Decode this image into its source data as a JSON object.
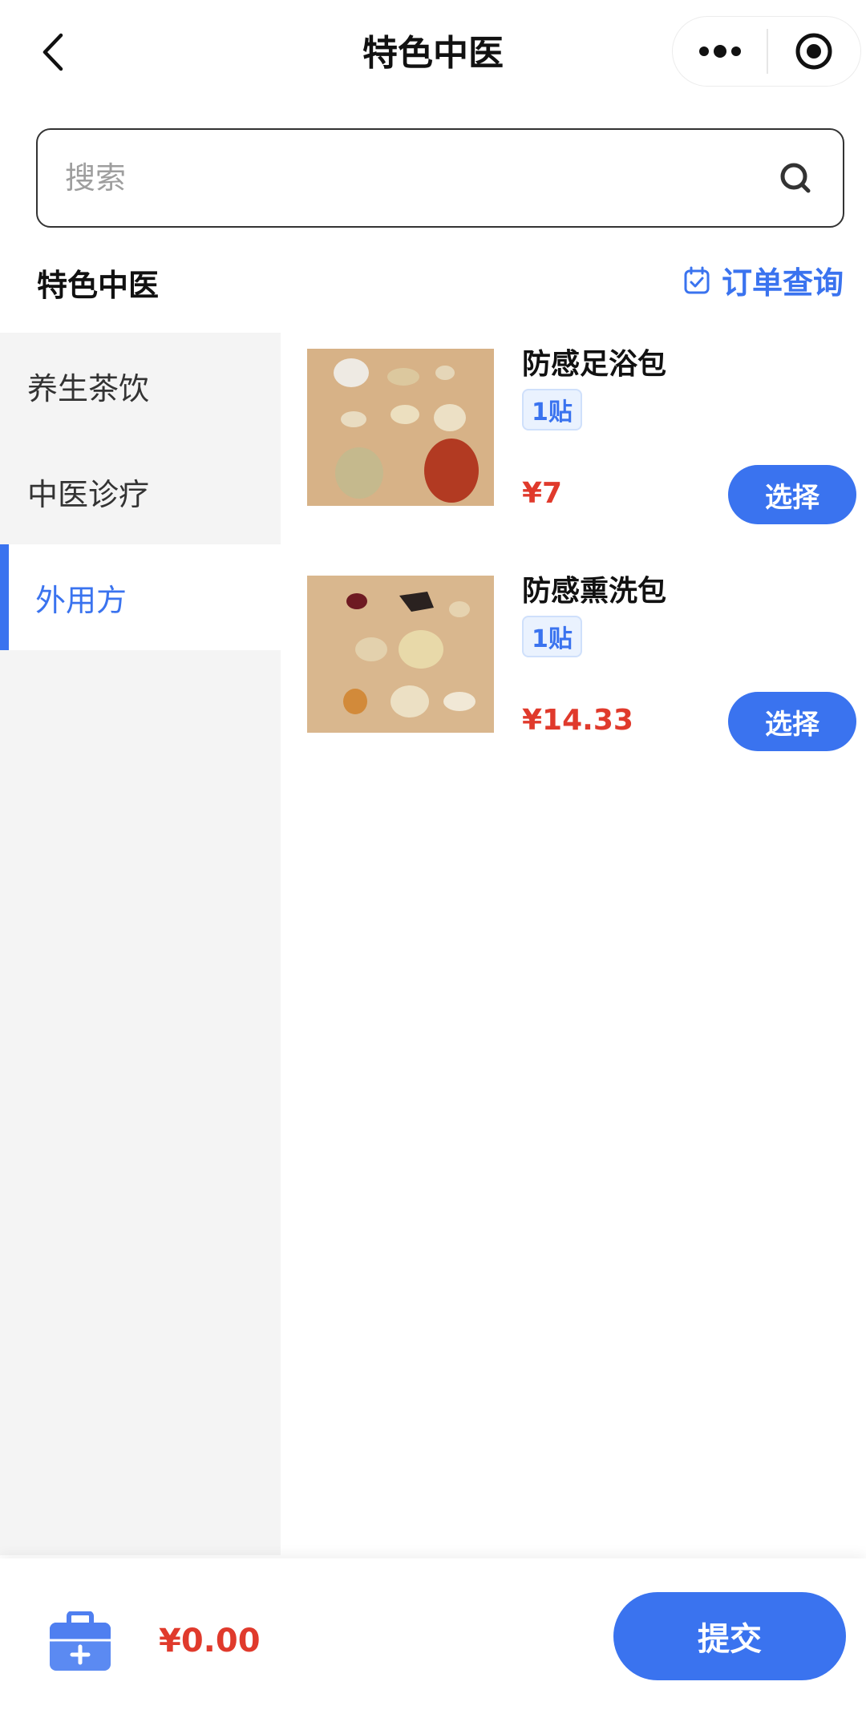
{
  "nav": {
    "title": "特色中医",
    "back_icon": "chevron-left-icon",
    "more_icon": "more-dots-icon",
    "close_icon": "target-close-icon"
  },
  "search": {
    "placeholder": "搜索",
    "value": "",
    "icon": "search-icon"
  },
  "section": {
    "title": "特色中医",
    "order_query": {
      "label": "订单查询",
      "icon": "calendar-check-icon"
    }
  },
  "sidebar": {
    "items": [
      {
        "label": "养生茶饮",
        "active": false
      },
      {
        "label": "中医诊疗",
        "active": false
      },
      {
        "label": "外用方",
        "active": true
      }
    ]
  },
  "products": [
    {
      "name": "防感足浴包",
      "unit": "1贴",
      "price": "¥7",
      "button": "选择"
    },
    {
      "name": "防感熏洗包",
      "unit": "1贴",
      "price": "¥14.33",
      "button": "选择"
    }
  ],
  "bottom": {
    "cart_icon": "medicine-box-icon",
    "total": "¥0.00",
    "submit": "提交"
  },
  "colors": {
    "accent": "#3a73ef",
    "price": "#e03a2c",
    "sidebar_bg": "#f4f4f4"
  }
}
